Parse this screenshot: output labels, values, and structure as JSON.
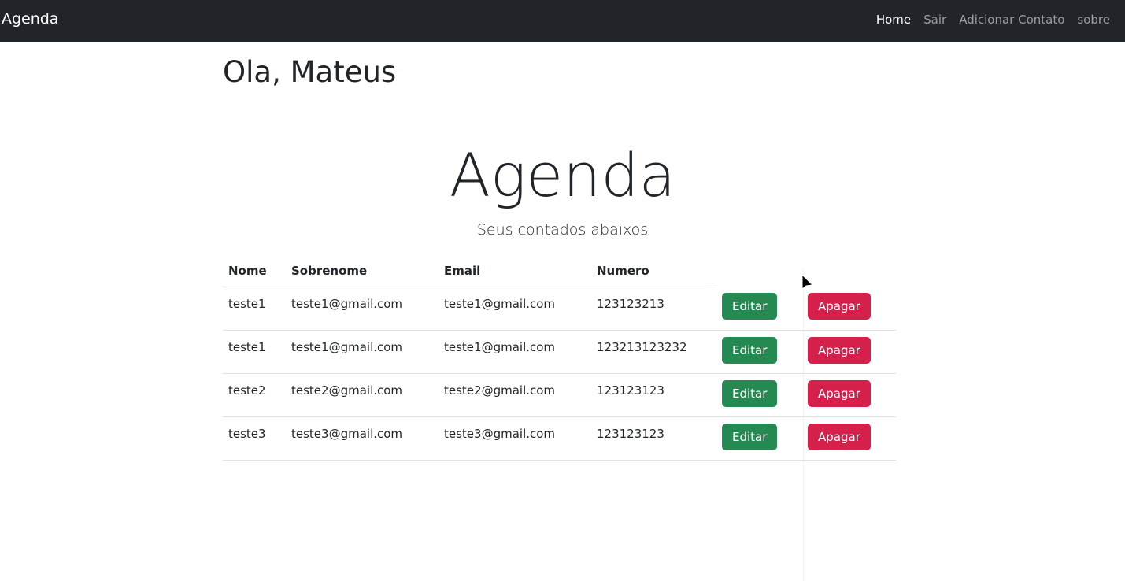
{
  "navbar": {
    "brand": "Agenda",
    "links": [
      {
        "label": "Home",
        "active": true
      },
      {
        "label": "Sair"
      },
      {
        "label": "Adicionar Contato"
      },
      {
        "label": "sobre"
      }
    ]
  },
  "greeting": "Ola, Mateus",
  "title": "Agenda",
  "subtitle": "Seus contados abaixos",
  "table": {
    "headers": [
      "Nome",
      "Sobrenome",
      "Email",
      "Numero"
    ],
    "edit_label": "Editar",
    "delete_label": "Apagar",
    "rows": [
      [
        "teste1",
        "teste1@gmail.com",
        "teste1@gmail.com",
        "123123213"
      ],
      [
        "teste1",
        "teste1@gmail.com",
        "teste1@gmail.com",
        "123213123232"
      ],
      [
        "teste2",
        "teste2@gmail.com",
        "teste2@gmail.com",
        "123123123"
      ],
      [
        "teste3",
        "teste3@gmail.com",
        "teste3@gmail.com",
        "123123123"
      ]
    ]
  },
  "colors": {
    "navbar": "#212529",
    "edit": "#258a52",
    "delete": "#d6204c"
  }
}
